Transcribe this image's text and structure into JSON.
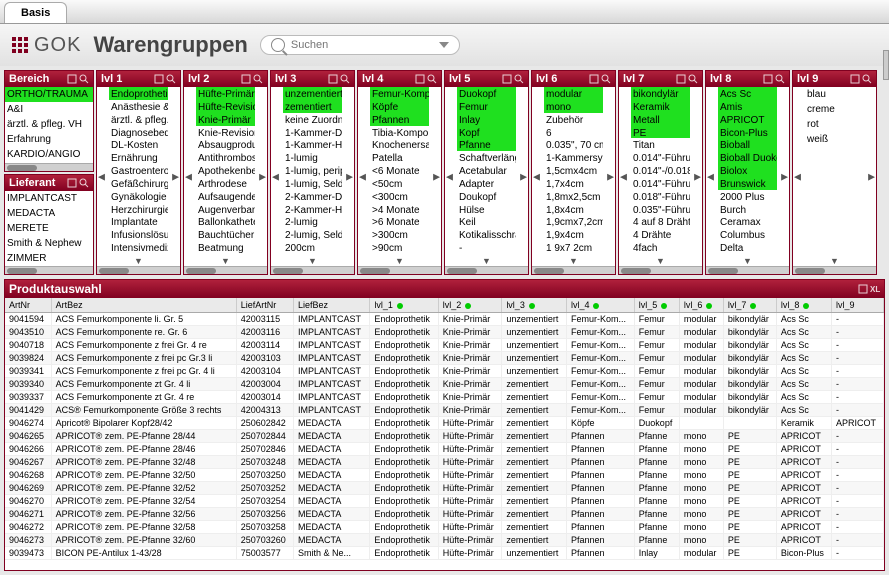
{
  "tab": "Basis",
  "brand": "GOK",
  "title": "Warengruppen",
  "search": {
    "placeholder": "Suchen"
  },
  "bereich": {
    "label": "Bereich",
    "items": [
      "ORTHO/TRAUMA",
      "A&I",
      "ärztl. & pfleg. VH",
      "Erfahrung",
      "KARDIO/ANGIO"
    ],
    "selected": [
      0
    ]
  },
  "lieferant": {
    "label": "Lieferant",
    "items": [
      "IMPLANTCAST",
      "MEDACTA",
      "MERETE",
      "Smith & Nephew",
      "ZIMMER"
    ],
    "selected": []
  },
  "levels": [
    {
      "label": "lvl 1",
      "items": [
        "Endoprothetik",
        "Anästhesie & I",
        "ärztl. & pfleg. V",
        "Diagnosebeda",
        "DL-Kosten",
        "Ernährung",
        "Gastroenterolo",
        "Gefäßchirurgie",
        "Gynäkologie",
        "Herzchirurgie",
        "Implantate",
        "Infusionslösun",
        "Intensivmediz"
      ],
      "selected": [
        0
      ]
    },
    {
      "label": "lvl 2",
      "items": [
        "Hüfte-Primär",
        "Hüfte-Revision",
        "Knie-Primär",
        "Knie-Revision",
        "Absaugprodukt",
        "Antithrombose",
        "Apothekenbed",
        "Arthrodese",
        "Aufsaugender I",
        "Augenverband",
        "Ballonkatheter",
        "Bauchtücher",
        "Beatmung"
      ],
      "selected": [
        0,
        1,
        2
      ]
    },
    {
      "label": "lvl 3",
      "items": [
        "unzementiert",
        "zementiert",
        "keine Zuordnu",
        "1-Kammer-Def",
        "1-Kammer-Her",
        "1-lumig",
        "1-lumig, perip",
        "1-lumig, Seldin",
        "2-Kammer-Def",
        "2-Kammer-Her",
        "2-lumig",
        "2-lumig, Seldin",
        "200cm"
      ],
      "selected": [
        0,
        1
      ]
    },
    {
      "label": "lvl 4",
      "items": [
        "Femur-Kompon",
        "Köpfe",
        "Pfannen",
        "Tibia-Kompone",
        "Knochenersatz",
        "Patella",
        "<6 Monate",
        "<50cm",
        "<300cm",
        ">4 Monate",
        ">6 Monate",
        ">300cm",
        ">90cm"
      ],
      "selected": [
        0,
        1,
        2
      ]
    },
    {
      "label": "lvl 5",
      "items": [
        "Duokopf",
        "Femur",
        "Inlay",
        "Kopf",
        "Pfanne",
        "Schaftverlänge",
        "Acetabular",
        "Adapter",
        "Doukopf",
        "Hülse",
        "Keil",
        "Kotikalisschra",
        "-"
      ],
      "selected": [
        0,
        1,
        2,
        3,
        4
      ]
    },
    {
      "label": "lvl 6",
      "items": [
        "modular",
        "mono",
        "Zubehör",
        "6",
        "0.035\", 70 cm",
        "1-Kammersyst",
        "1,5cmx4cm",
        "1,7x4cm",
        "1,8mx2,5cm",
        "1,8x4cm",
        "1,9cmx7,2cm",
        "1,9x4cm",
        "1 9x7 2cm"
      ],
      "selected": [
        0,
        1
      ]
    },
    {
      "label": "lvl 7",
      "items": [
        "bikondylär",
        "Keramik",
        "Metall",
        "PE",
        "Titan",
        "0.014\"-Führun",
        "0.014\"-/0.018\"",
        "0.014\"-Führun",
        "0.018\"-Führun",
        "0.035\"-Führun",
        "4 auf 8 Drähte",
        "4 Drähte",
        "4fach"
      ],
      "selected": [
        0,
        1,
        2,
        3
      ]
    },
    {
      "label": "lvl 8",
      "items": [
        "Acs Sc",
        "Amis",
        "APRICOT",
        "Bicon-Plus",
        "Bioball",
        "Bioball Duokop",
        "Biolox",
        "Brunswick",
        "2000 Plus",
        "Burch",
        "Ceramax",
        "Columbus",
        "Delta"
      ],
      "selected": [
        0,
        1,
        2,
        3,
        4,
        5,
        6,
        7
      ]
    },
    {
      "label": "lvl 9",
      "items": [
        "blau",
        "creme",
        "rot",
        "weiß"
      ],
      "selected": []
    }
  ],
  "productPanel": {
    "label": "Produktauswahl"
  },
  "columns": [
    "ArtNr",
    "ArtBez",
    "LiefArtNr",
    "LiefBez",
    "lvl_1",
    "lvl_2",
    "lvl_3",
    "lvl_4",
    "lvl_5",
    "lvl_6",
    "lvl_7",
    "lvl_8",
    "lvl_9"
  ],
  "dotCols": [
    4,
    5,
    6,
    7,
    8,
    9,
    10,
    11
  ],
  "rows": [
    [
      "9041594",
      "ACS Femurkomponente li. Gr. 5",
      "42003115",
      "IMPLANTCAST",
      "Endoprothetik",
      "Knie-Primär",
      "unzementiert",
      "Femur-Kom...",
      "Femur",
      "modular",
      "bikondylär",
      "Acs Sc",
      "-"
    ],
    [
      "9043510",
      "ACS Femurkomponente re. Gr. 6",
      "42003116",
      "IMPLANTCAST",
      "Endoprothetik",
      "Knie-Primär",
      "unzementiert",
      "Femur-Kom...",
      "Femur",
      "modular",
      "bikondylär",
      "Acs Sc",
      "-"
    ],
    [
      "9040718",
      "ACS Femurkomponente z frei Gr. 4 re",
      "42003114",
      "IMPLANTCAST",
      "Endoprothetik",
      "Knie-Primär",
      "unzementiert",
      "Femur-Kom...",
      "Femur",
      "modular",
      "bikondylär",
      "Acs Sc",
      "-"
    ],
    [
      "9039824",
      "ACS Femurkomponente z frei pc Gr.3 li",
      "42003103",
      "IMPLANTCAST",
      "Endoprothetik",
      "Knie-Primär",
      "unzementiert",
      "Femur-Kom...",
      "Femur",
      "modular",
      "bikondylär",
      "Acs Sc",
      "-"
    ],
    [
      "9039341",
      "ACS Femurkomponente z frei pc Gr. 4 li",
      "42003104",
      "IMPLANTCAST",
      "Endoprothetik",
      "Knie-Primär",
      "unzementiert",
      "Femur-Kom...",
      "Femur",
      "modular",
      "bikondylär",
      "Acs Sc",
      "-"
    ],
    [
      "9039340",
      "ACS Femurkomponente zt Gr. 4 li",
      "42003004",
      "IMPLANTCAST",
      "Endoprothetik",
      "Knie-Primär",
      "zementiert",
      "Femur-Kom...",
      "Femur",
      "modular",
      "bikondylär",
      "Acs Sc",
      "-"
    ],
    [
      "9039337",
      "ACS Femurkomponente zt Gr. 4 re",
      "42003014",
      "IMPLANTCAST",
      "Endoprothetik",
      "Knie-Primär",
      "zementiert",
      "Femur-Kom...",
      "Femur",
      "modular",
      "bikondylär",
      "Acs Sc",
      "-"
    ],
    [
      "9041429",
      "ACS® Femurkomponente Größe 3 rechts",
      "42004313",
      "IMPLANTCAST",
      "Endoprothetik",
      "Knie-Primär",
      "zementiert",
      "Femur-Kom...",
      "Femur",
      "modular",
      "bikondylär",
      "Acs Sc",
      "-"
    ],
    [
      "9046274",
      "Apricot® Bipolarer Kopf28/42",
      "250602842",
      "MEDACTA",
      "Endoprothetik",
      "Hüfte-Primär",
      "zementiert",
      "Köpfe",
      "Duokopf",
      "",
      "",
      "Keramik",
      "APRICOT"
    ],
    [
      "9046265",
      "APRICOT® zem. PE-Pfanne 28/44",
      "250702844",
      "MEDACTA",
      "Endoprothetik",
      "Hüfte-Primär",
      "zementiert",
      "Pfannen",
      "Pfanne",
      "mono",
      "PE",
      "APRICOT",
      "-"
    ],
    [
      "9046266",
      "APRICOT® zem. PE-Pfanne 28/46",
      "250702846",
      "MEDACTA",
      "Endoprothetik",
      "Hüfte-Primär",
      "zementiert",
      "Pfannen",
      "Pfanne",
      "mono",
      "PE",
      "APRICOT",
      "-"
    ],
    [
      "9046267",
      "APRICOT® zem. PE-Pfanne 32/48",
      "250703248",
      "MEDACTA",
      "Endoprothetik",
      "Hüfte-Primär",
      "zementiert",
      "Pfannen",
      "Pfanne",
      "mono",
      "PE",
      "APRICOT",
      "-"
    ],
    [
      "9046268",
      "APRICOT® zem. PE-Pfanne 32/50",
      "250703250",
      "MEDACTA",
      "Endoprothetik",
      "Hüfte-Primär",
      "zementiert",
      "Pfannen",
      "Pfanne",
      "mono",
      "PE",
      "APRICOT",
      "-"
    ],
    [
      "9046269",
      "APRICOT® zem. PE-Pfanne 32/52",
      "250703252",
      "MEDACTA",
      "Endoprothetik",
      "Hüfte-Primär",
      "zementiert",
      "Pfannen",
      "Pfanne",
      "mono",
      "PE",
      "APRICOT",
      "-"
    ],
    [
      "9046270",
      "APRICOT® zem. PE-Pfanne 32/54",
      "250703254",
      "MEDACTA",
      "Endoprothetik",
      "Hüfte-Primär",
      "zementiert",
      "Pfannen",
      "Pfanne",
      "mono",
      "PE",
      "APRICOT",
      "-"
    ],
    [
      "9046271",
      "APRICOT® zem. PE-Pfanne 32/56",
      "250703256",
      "MEDACTA",
      "Endoprothetik",
      "Hüfte-Primär",
      "zementiert",
      "Pfannen",
      "Pfanne",
      "mono",
      "PE",
      "APRICOT",
      "-"
    ],
    [
      "9046272",
      "APRICOT® zem. PE-Pfanne 32/58",
      "250703258",
      "MEDACTA",
      "Endoprothetik",
      "Hüfte-Primär",
      "zementiert",
      "Pfannen",
      "Pfanne",
      "mono",
      "PE",
      "APRICOT",
      "-"
    ],
    [
      "9046273",
      "APRICOT® zem. PE-Pfanne 32/60",
      "250703260",
      "MEDACTA",
      "Endoprothetik",
      "Hüfte-Primär",
      "zementiert",
      "Pfannen",
      "Pfanne",
      "mono",
      "PE",
      "APRICOT",
      "-"
    ],
    [
      "9039473",
      "BICON PE-Antilux 1-43/28",
      "75003577",
      "Smith & Ne...",
      "Endoprothetik",
      "Hüfte-Primär",
      "unzementiert",
      "Pfannen",
      "Inlay",
      "modular",
      "PE",
      "Bicon-Plus",
      "-"
    ]
  ]
}
